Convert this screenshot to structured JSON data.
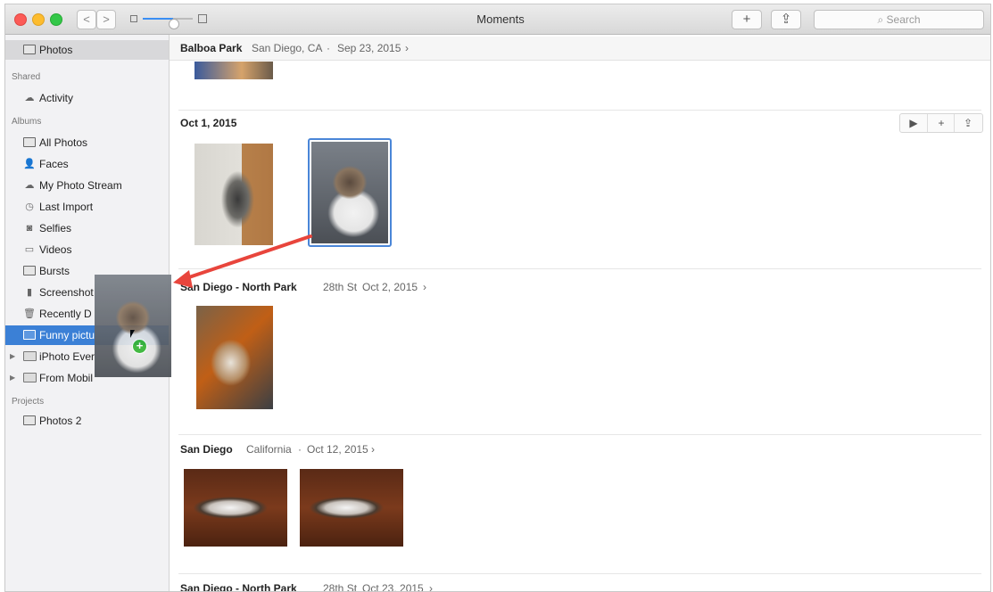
{
  "window": {
    "title": "Moments",
    "search_placeholder": "Search",
    "add_symbol": "+",
    "share_symbol": "⇪",
    "back_symbol": "<",
    "forward_symbol": ">",
    "zoom_level": 0.6
  },
  "sidebar": {
    "top_item": "Photos",
    "shared_header": "Shared",
    "shared_items": [
      "Activity"
    ],
    "albums_header": "Albums",
    "albums": [
      {
        "label": "All Photos",
        "icon": "album-icon"
      },
      {
        "label": "Faces",
        "icon": "person-icon"
      },
      {
        "label": "My Photo Stream",
        "icon": "cloud-icon"
      },
      {
        "label": "Last Import",
        "icon": "clock-icon"
      },
      {
        "label": "Selfies",
        "icon": "camera-icon"
      },
      {
        "label": "Videos",
        "icon": "video-icon"
      },
      {
        "label": "Bursts",
        "icon": "burst-icon"
      },
      {
        "label": "Screenshot",
        "icon": "phone-icon"
      },
      {
        "label": "Recently D",
        "icon": "trash-icon"
      },
      {
        "label": "Funny pictu",
        "icon": "album-icon"
      },
      {
        "label": "iPhoto Ever",
        "icon": "folder-icon"
      },
      {
        "label": "From Mobil",
        "icon": "folder-icon"
      }
    ],
    "projects_header": "Projects",
    "projects": [
      "Photos 2"
    ]
  },
  "moments": [
    {
      "title": "Balboa Park",
      "location": "San Diego, CA",
      "date": "Sep 23, 2015",
      "chev": "›"
    },
    {
      "title": "Oct 1, 2015",
      "location": "",
      "date": "",
      "chev": ""
    },
    {
      "title": "San Diego - North Park",
      "location": "28th St",
      "date": "Oct 2, 2015",
      "chev": "›"
    },
    {
      "title": "San Diego",
      "location": "California",
      "date": "Oct 12, 2015",
      "chev": "›"
    },
    {
      "title": "San Diego - North Park",
      "location": "28th St",
      "date": "Oct 23, 2015",
      "chev": "›"
    }
  ],
  "section_tools": {
    "play": "▶",
    "add": "+",
    "share": "⇪"
  },
  "separator": "·",
  "drag_badge": "+"
}
